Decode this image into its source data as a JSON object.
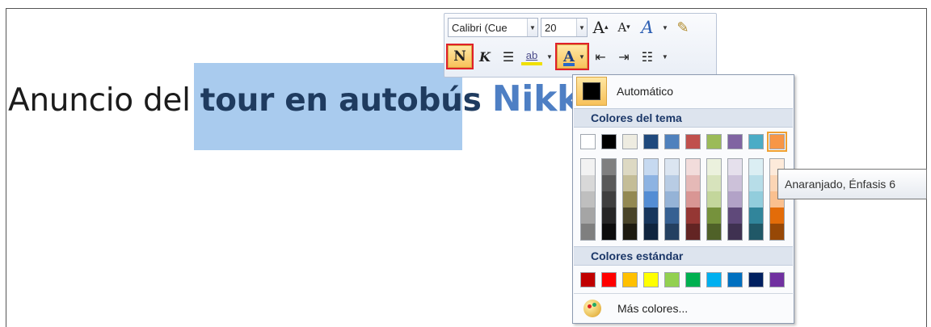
{
  "document": {
    "text_plain": "Anuncio del ",
    "text_selected": "tour en autobús ",
    "text_partial": "Nikk"
  },
  "mini_toolbar": {
    "font_name": "Calibri (Cue",
    "font_size": "20",
    "grow_font_glyph": "A",
    "shrink_font_glyph": "A",
    "bold_label": "N",
    "italic_label": "K",
    "font_color_letter": "A"
  },
  "color_menu": {
    "automatic_label": "Automático",
    "theme_colors_header": "Colores del tema",
    "standard_colors_header": "Colores estándar",
    "more_colors_label": "Más colores...",
    "theme_top_row": [
      "#ffffff",
      "#000000",
      "#eeece1",
      "#1f497d",
      "#4f81bd",
      "#c0504d",
      "#9bbb59",
      "#8064a2",
      "#4bacc6",
      "#f79646"
    ],
    "theme_shades": [
      [
        "#f2f2f2",
        "#d8d8d8",
        "#bfbfbf",
        "#a5a5a5",
        "#7f7f7f"
      ],
      [
        "#7f7f7f",
        "#595959",
        "#3f3f3f",
        "#262626",
        "#0c0c0c"
      ],
      [
        "#ddd9c3",
        "#c4bd97",
        "#938953",
        "#494429",
        "#1d1b10"
      ],
      [
        "#c6d9f0",
        "#8db3e2",
        "#548dd4",
        "#17365d",
        "#0f243e"
      ],
      [
        "#dbe5f1",
        "#b8cce4",
        "#95b3d7",
        "#366092",
        "#244061"
      ],
      [
        "#f2dcdb",
        "#e5b9b7",
        "#d99694",
        "#953734",
        "#632423"
      ],
      [
        "#ebf1dd",
        "#d7e3bc",
        "#c3d69b",
        "#76923c",
        "#4f6128"
      ],
      [
        "#e5e0ec",
        "#ccc1d9",
        "#b2a2c7",
        "#5f497a",
        "#3f3151"
      ],
      [
        "#dbeef3",
        "#b7dde8",
        "#92cddc",
        "#31859b",
        "#205867"
      ],
      [
        "#fdeada",
        "#fbd5b5",
        "#fac08f",
        "#e36c09",
        "#974806"
      ]
    ],
    "standard_colors": [
      "#c00000",
      "#ff0000",
      "#ffc000",
      "#ffff00",
      "#92d050",
      "#00b050",
      "#00b0f0",
      "#0070c0",
      "#002060",
      "#7030a0"
    ],
    "highlighted_swatch_color": "#f79646"
  },
  "tooltip": {
    "text": "Anaranjado, Énfasis 6"
  }
}
